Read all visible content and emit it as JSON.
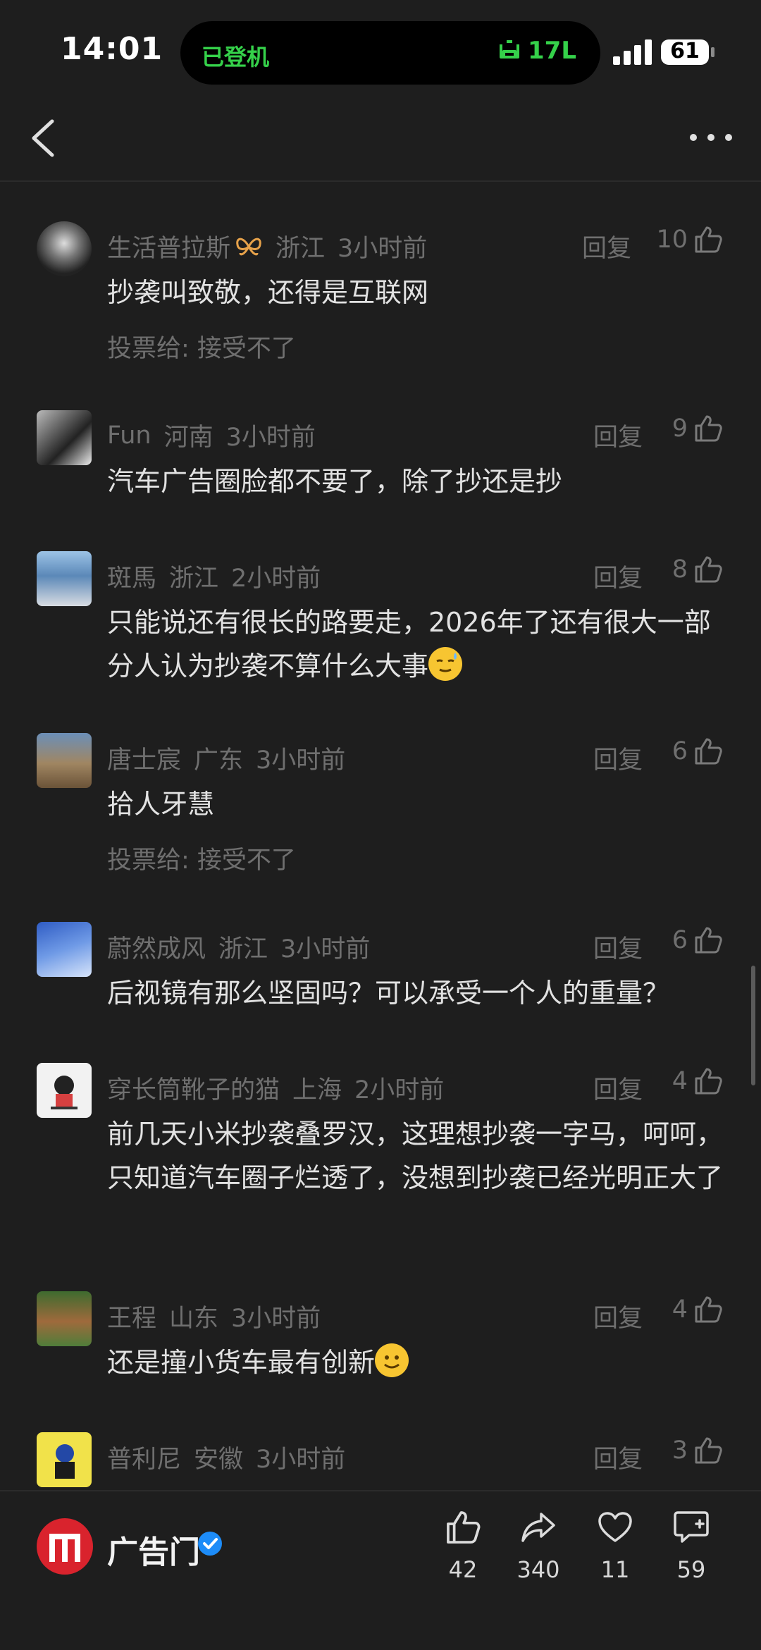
{
  "status_bar": {
    "time": "14:01",
    "island_left": "已登机",
    "island_right": "17L",
    "battery": "61"
  },
  "comments": [
    {
      "user": "生活普拉斯",
      "location": "浙江",
      "time": "3小时前",
      "reply": "回复",
      "likes": "10",
      "text": "抄袭叫致敬，还得是互联网",
      "vote": "投票给: 接受不了"
    },
    {
      "user": "Fun",
      "location": "河南",
      "time": "3小时前",
      "reply": "回复",
      "likes": "9",
      "text": "汽车广告圈脸都不要了，除了抄还是抄"
    },
    {
      "user": "斑馬",
      "location": "浙江",
      "time": "2小时前",
      "reply": "回复",
      "likes": "8",
      "text": "只能说还有很长的路要走，2026年了还有很大一部分人认为抄袭不算什么大事"
    },
    {
      "user": "唐士宸",
      "location": "广东",
      "time": "3小时前",
      "reply": "回复",
      "likes": "6",
      "text": "拾人牙慧",
      "vote": "投票给: 接受不了"
    },
    {
      "user": "蔚然成风",
      "location": "浙江",
      "time": "3小时前",
      "reply": "回复",
      "likes": "6",
      "text": "后视镜有那么坚固吗？可以承受一个人的重量？"
    },
    {
      "user": "穿长筒靴子的猫",
      "location": "上海",
      "time": "2小时前",
      "reply": "回复",
      "likes": "4",
      "text": "前几天小米抄袭叠罗汉，这理想抄袭一字马，呵呵，只知道汽车圈子烂透了，没想到抄袭已经光明正大了"
    },
    {
      "user": "王程",
      "location": "山东",
      "time": "3小时前",
      "reply": "回复",
      "likes": "4",
      "text": "还是撞小货车最有创新"
    },
    {
      "user": "普利尼",
      "location": "安徽",
      "time": "3小时前",
      "reply": "回复",
      "likes": "3",
      "text": ""
    }
  ],
  "bottom_bar": {
    "brand_name": "广告门",
    "likes": "42",
    "shares": "340",
    "favorites": "11",
    "comments": "59"
  },
  "colors": {
    "background": "#1e1e1e",
    "muted": "#6f6f6f",
    "text": "#e2e2e2",
    "island_green": "#35d14a",
    "brand_red": "#d9232d",
    "verified_blue": "#1d8cf8"
  },
  "icons": [
    "back-icon",
    "more-icon",
    "thumb-up-icon",
    "share-icon",
    "heart-icon",
    "comment-add-icon",
    "verified-icon",
    "signal-icon",
    "battery-icon",
    "butterfly-icon"
  ]
}
